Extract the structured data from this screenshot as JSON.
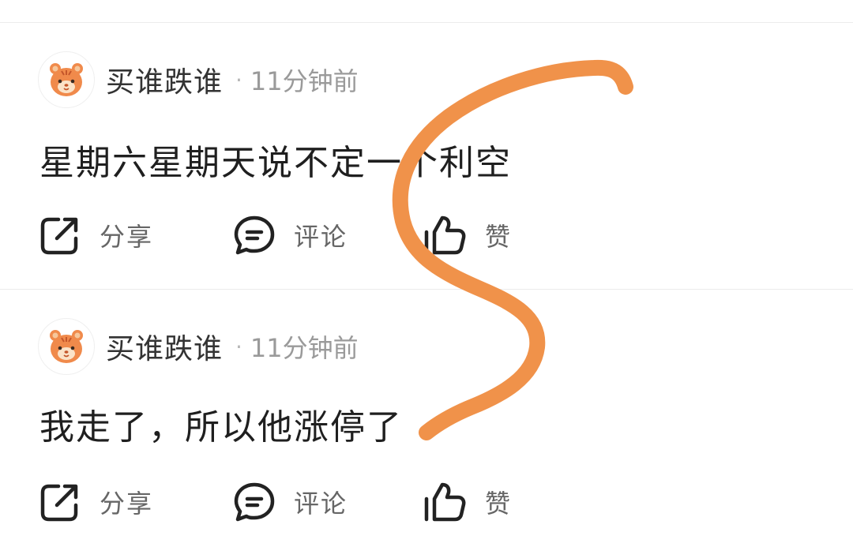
{
  "feed": {
    "posts": [
      {
        "author": "买谁跌谁",
        "separator": "·",
        "time": "11分钟前",
        "content": "星期六星期天说不定一个利空",
        "actions": {
          "share": "分享",
          "comment": "评论",
          "like": "赞"
        }
      },
      {
        "author": "买谁跌谁",
        "separator": "·",
        "time": "11分钟前",
        "content": "我走了，所以他涨停了",
        "actions": {
          "share": "分享",
          "comment": "评论",
          "like": "赞"
        }
      }
    ]
  },
  "colors": {
    "annotation_stroke": "#f0924a",
    "avatar_tiger": "#f08a4b"
  },
  "icons": [
    "tiger-avatar-icon",
    "share-icon",
    "comment-icon",
    "like-icon"
  ]
}
